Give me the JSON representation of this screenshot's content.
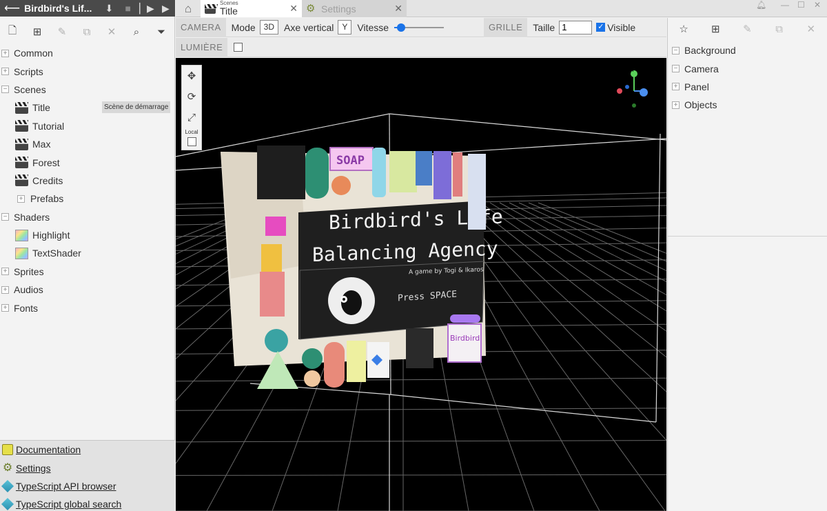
{
  "project": {
    "title": "Birdbird's Lif...",
    "back_icon": "arrow-left-icon",
    "controls": [
      "download-icon",
      "stop-icon",
      "step-play-icon",
      "play-icon"
    ]
  },
  "left_toolbar": [
    "new-asset-icon",
    "new-folder-icon",
    "rename-icon",
    "duplicate-icon",
    "delete-icon",
    "search-icon",
    "filter-icon"
  ],
  "tree": {
    "common": "Common",
    "scripts": "Scripts",
    "scenes": "Scenes",
    "scenes_children": [
      "Title",
      "Tutorial",
      "Max",
      "Forest",
      "Credits"
    ],
    "start_badge": "Scène de démarrage",
    "prefabs": "Prefabs",
    "shaders": "Shaders",
    "shaders_children": [
      "Highlight",
      "TextShader"
    ],
    "sprites": "Sprites",
    "audios": "Audios",
    "fonts": "Fonts"
  },
  "links": [
    "Documentation",
    "Settings",
    "TypeScript API browser",
    "TypeScript global search"
  ],
  "tabs": {
    "home_icon": "home-icon",
    "active_small": "Scenes",
    "active": "Title",
    "inactive": "Settings"
  },
  "scene_toolbar": {
    "camera_label": "CAMERA",
    "mode_label": "Mode",
    "mode_value": "3D",
    "vertical_axis_label": "Axe vertical",
    "vertical_axis_value": "Y",
    "speed_label": "Vitesse",
    "speed_fraction": 0.08,
    "grid_label": "GRILLE",
    "size_label": "Taille",
    "size_value": "1",
    "visible_label": "Visible",
    "visible_checked": true,
    "light_label": "LUMIÈRE",
    "light_checked": false
  },
  "viewport": {
    "tools": [
      "move-icon",
      "rotate-icon",
      "scale-icon"
    ],
    "local_label": "Local",
    "title_line1": "Birdbird's Life",
    "title_line2": "Balancing Agency",
    "byline": "A game by Togi & Ikaros",
    "press": "Press SPACE",
    "soap": "SOAP",
    "birdbird": "Birdbird",
    "gizmo_y": "Y"
  },
  "right_toolbar": [
    "new-actor-icon",
    "new-prefab-icon",
    "rename-icon",
    "duplicate-icon",
    "delete-icon"
  ],
  "actors": [
    "Background",
    "Camera",
    "Panel",
    "Objects"
  ]
}
